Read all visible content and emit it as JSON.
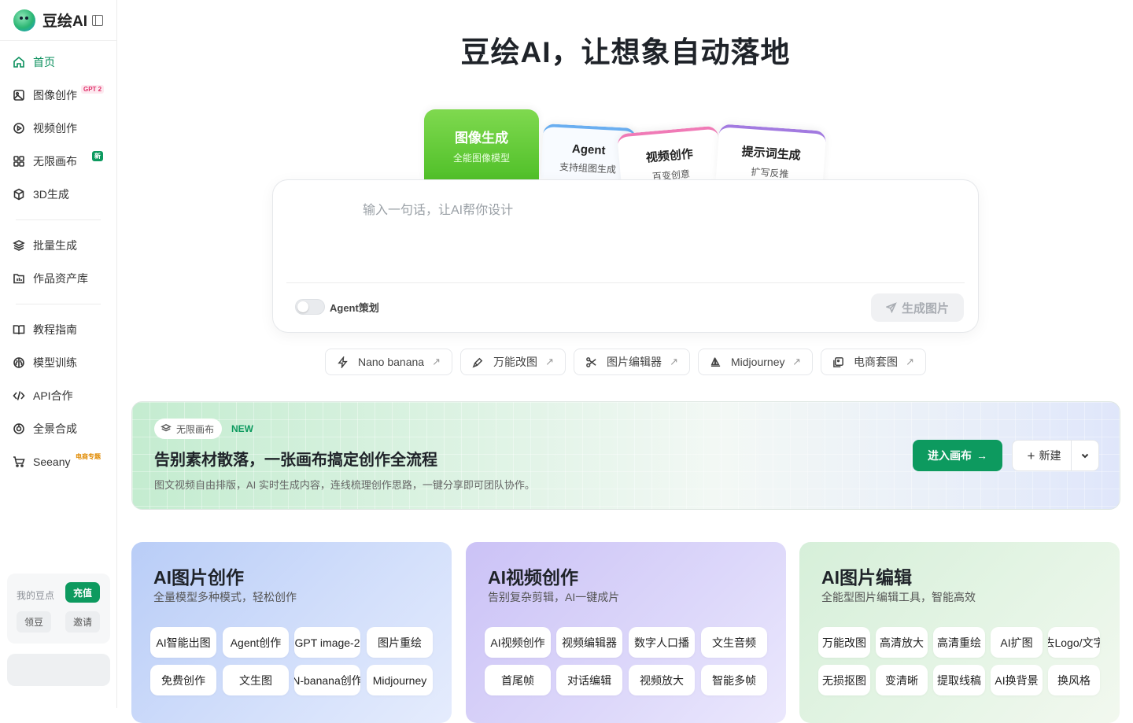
{
  "brand": {
    "name": "豆绘AI"
  },
  "nav": {
    "home": "首页",
    "image": "图像创作",
    "image_badge": "GPT 2",
    "video": "视频创作",
    "canvas": "无限画布",
    "canvas_badge": "新",
    "three_d": "3D生成",
    "batch": "批量生成",
    "assets": "作品资产库",
    "tutorial": "教程指南",
    "training": "模型训练",
    "api": "API合作",
    "panorama": "全景合成",
    "seeany": "Seeany",
    "seeany_badge": "电商专题"
  },
  "wallet": {
    "label": "我的豆点",
    "recharge": "充值",
    "claim": "领豆",
    "invite": "邀请"
  },
  "hero": {
    "title": "豆绘AI，让想象自动落地"
  },
  "tabs": [
    {
      "title": "图像生成",
      "subtitle": "全能图像模型"
    },
    {
      "title": "Agent",
      "subtitle": "支持组图生成"
    },
    {
      "title": "视频创作",
      "subtitle": "百变创意"
    },
    {
      "title": "提示词生成",
      "subtitle": "扩写反推"
    }
  ],
  "composer": {
    "placeholder": "输入一句话，让AI帮你设计",
    "agent_toggle": "Agent策划",
    "generate": "生成图片"
  },
  "quick_tools": [
    "Nano banana",
    "万能改图",
    "图片编辑器",
    "Midjourney",
    "电商套图"
  ],
  "banner": {
    "pill": "无限画布",
    "tag": "NEW",
    "title": "告别素材散落，一张画布搞定创作全流程",
    "subtitle": "图文视频自由排版，AI 实时生成内容，连线梳理创作思路，一键分享即可团队协作。",
    "enter": "进入画布",
    "new": "新建"
  },
  "cards": [
    {
      "title": "AI图片创作",
      "subtitle": "全量模型多种模式，轻松创作",
      "buttons": [
        "AI智能出图",
        "Agent创作",
        "GPT image-2",
        "图片重绘",
        "免费创作",
        "文生图",
        "N-banana创作",
        "Midjourney"
      ]
    },
    {
      "title": "AI视频创作",
      "subtitle": "告别复杂剪辑，AI一键成片",
      "buttons": [
        "AI视频创作",
        "视频编辑器",
        "数字人口播",
        "文生音频",
        "首尾帧",
        "对话编辑",
        "视频放大",
        "智能多帧"
      ]
    },
    {
      "title": "AI图片编辑",
      "subtitle": "全能型图片编辑工具，智能高效",
      "buttons": [
        "万能改图",
        "高清放大",
        "高清重绘",
        "AI扩图",
        "去Logo/文字",
        "无损抠图",
        "变清晰",
        "提取线稿",
        "AI换背景",
        "换风格"
      ]
    }
  ],
  "colors": {
    "accent": "#0d9a5f",
    "primary_tab": "#5cc934"
  }
}
